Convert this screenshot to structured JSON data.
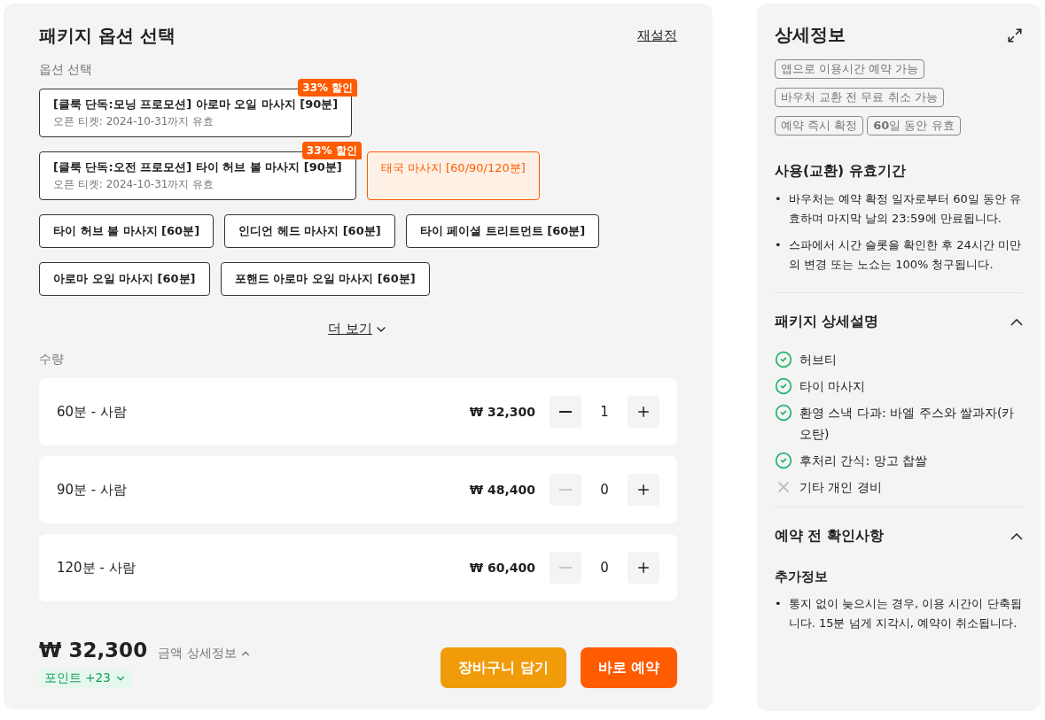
{
  "title": "패키지 옵션 선택",
  "reset": "재설정",
  "options_label": "옵션 선택",
  "options": [
    {
      "kind": "promo",
      "label": "[클룩 단독:모닝 프로모션] 아로마 오일 마사지 [90분]",
      "sub": "오픈 티켓: 2024-10-31까지 유효",
      "badge": "33% 할인",
      "selected": false
    },
    {
      "kind": "promo",
      "label": "[클룩 단독:오전 프로모션] 타이 허브 볼 마사지 [90분]",
      "sub": "오픈 티켓: 2024-10-31까지 유효",
      "badge": "33% 할인",
      "selected": false
    },
    {
      "kind": "plain",
      "label": "태국 마사지 [60/90/120분]",
      "selected": true
    },
    {
      "kind": "plain",
      "label": "타이 허브 볼 마사지 [60분]",
      "selected": false
    },
    {
      "kind": "plain",
      "label": "인디언 헤드 마사지 [60분]",
      "selected": false
    },
    {
      "kind": "plain",
      "label": "타이 페이셜 트리트먼트 [60분]",
      "selected": false
    },
    {
      "kind": "plain",
      "label": "아로마 오일 마사지 [60분]",
      "selected": false
    },
    {
      "kind": "plain",
      "label": "포핸드 아로마 오일 마사지 [60분]",
      "selected": false
    }
  ],
  "more": "더 보기",
  "quantity_label": "수량",
  "quantities": [
    {
      "name": "60분 - 사람",
      "price": "₩ 32,300",
      "count": "1",
      "minus_disabled": false
    },
    {
      "name": "90분 - 사람",
      "price": "₩ 48,400",
      "count": "0",
      "minus_disabled": true
    },
    {
      "name": "120분 - 사람",
      "price": "₩ 60,400",
      "count": "0",
      "minus_disabled": true
    }
  ],
  "total": "₩ 32,300",
  "price_detail": "금액 상세정보",
  "points": "포인트 +23",
  "buttons": [
    {
      "kind": "cart",
      "label": "장바구니 담기"
    },
    {
      "kind": "book",
      "label": "바로 예약"
    }
  ],
  "details": {
    "title": "상세정보",
    "tags": [
      "앱으로 이용시간 예약 가능",
      "바우처 교환 전 무료 취소 가능",
      "예약 즉시 확정",
      "**60**일 동안 유효"
    ],
    "validity": {
      "title": "사용(교환) 유효기간",
      "bullet": "•",
      "bullets": [
        "바우처는 예약 확정 일자로부터 60일 동안 유효하며 마지막 날의 23:59에 만료됩니다.",
        "스파에서 시간 슬롯을 확인한 후 24시간 미만의 변경 또는 노쇼는 100% 청구됩니다."
      ]
    },
    "package": {
      "title": "패키지 상세설명",
      "expanded": true,
      "items": [
        {
          "label": "허브티",
          "included": true
        },
        {
          "label": "타이 마사지",
          "included": true
        },
        {
          "label": "환영 스낵 다과: 바엘 주스와 쌀과자(카오탄)",
          "included": true
        },
        {
          "label": "후처리 간식: 망고 찹쌀",
          "included": true
        },
        {
          "label": "기타 개인 경비",
          "included": false
        }
      ]
    },
    "notice": {
      "title": "예약 전 확인사항",
      "expanded": true,
      "subtitle": "추가정보",
      "bullet": "•",
      "bullets": [
        "통지 없이 늦으시는 경우, 이용 시간이 단축됩니다. 15분 넘게 지각시, 예약이 취소됩니다."
      ]
    }
  }
}
